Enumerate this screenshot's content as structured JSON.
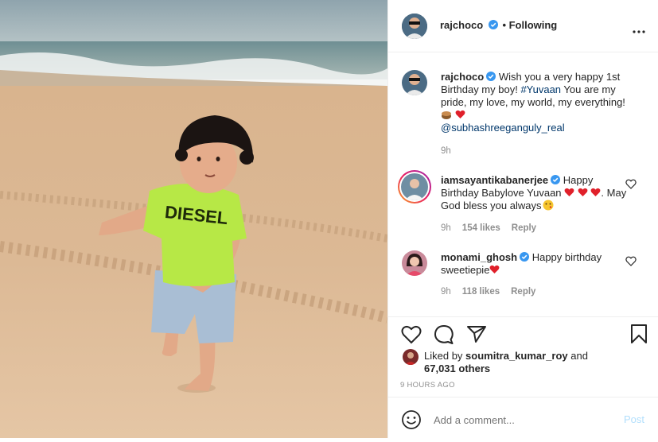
{
  "post_author": {
    "username": "rajchoco",
    "follow_state": "• Following"
  },
  "caption": {
    "username": "rajchoco",
    "text_1": "Wish you a very happy 1st Birthday my boy! ",
    "hashtag": "#Yuvaan",
    "text_2": " You are my pride, my love, my world, my everything! ",
    "mention": "@subhashreeganguly_real",
    "time": "9h"
  },
  "comments": [
    {
      "username": "iamsayantikabanerjee",
      "text_1": "Happy Birthday Babylove Yuvaan ",
      "text_2": ". May God bless you always",
      "time": "9h",
      "likes": "154 likes",
      "reply": "Reply"
    },
    {
      "username": "monami_ghosh",
      "text_1": "Happy birthday sweetiepie",
      "time": "9h",
      "likes": "118 likes",
      "reply": "Reply"
    }
  ],
  "likes_summary": {
    "prefix": "Liked by ",
    "user": "soumitra_kumar_roy",
    "middle": " and",
    "count": "67,031 others"
  },
  "timestamp": "9 HOURS AGO",
  "add_comment": {
    "placeholder": "Add a comment...",
    "post_label": "Post"
  },
  "photo": {
    "shirt_text": "DIESEL"
  },
  "colors": {
    "verified": "#3897f0",
    "heart": "#ed4956",
    "post_disabled": "#b2dffc"
  }
}
